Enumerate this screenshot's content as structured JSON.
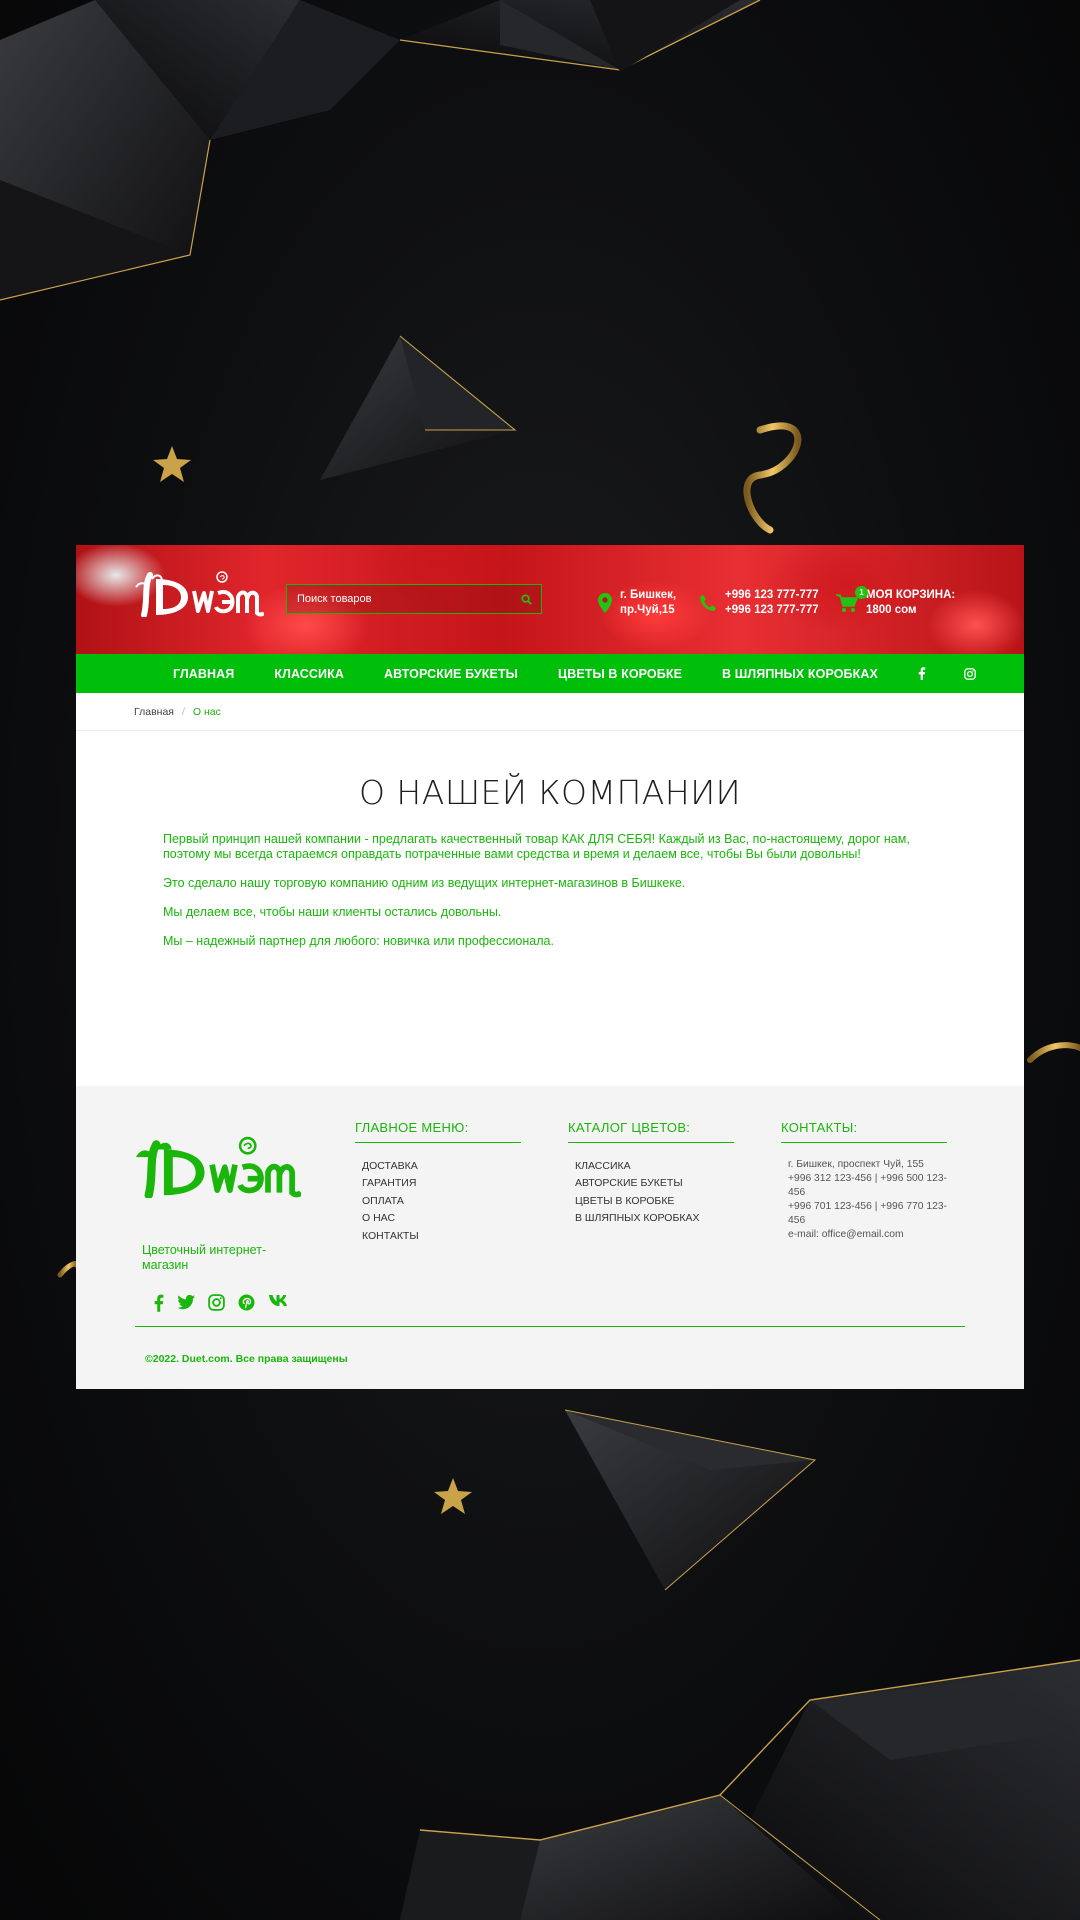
{
  "header": {
    "search_placeholder": "Поиск товаров",
    "address_line1": "г. Бишкек,",
    "address_line2": "пр.Чуй,15",
    "phone1": "+996 123 777-777",
    "phone2": "+996 123 777-777",
    "cart_label": "МОЯ КОРЗИНА:",
    "cart_total": "1800 сом",
    "cart_count": "1"
  },
  "nav": {
    "items": [
      "ГЛАВНАЯ",
      "КЛАССИКА",
      "АВТОРСКИЕ БУКЕТЫ",
      "ЦВЕТЫ В КОРОБКЕ",
      "В ШЛЯПНЫХ КОРОБКАХ"
    ],
    "social": [
      "facebook-icon",
      "instagram-icon"
    ]
  },
  "breadcrumb": {
    "home": "Главная",
    "separator": "/",
    "current": "О нас"
  },
  "main": {
    "title": "О НАШЕЙ КОМПАНИИ",
    "paragraphs": [
      "Первый принцип нашей компании - предлагать качественный товар КАК ДЛЯ СЕБЯ! Каждый из Вас, по-настоящему, дорог нам, поэтому мы всегда стараемся оправдать потраченные вами средства и время и делаем все, чтобы Вы были довольны!",
      "Это сделало нашу торговую компанию одним из ведущих интернет-магазинов в Бишкеке.",
      "Мы делаем все, чтобы наши клиенты остались довольны.",
      "Мы – надежный партнер для любого: новичка или профессионала."
    ]
  },
  "footer": {
    "tagline": "Цветочный интернет-магазин",
    "menu_title": "ГЛАВНОЕ МЕНЮ:",
    "menu_items": [
      "ДОСТАВКА",
      "ГАРАНТИЯ",
      "ОПЛАТА",
      "О НАС",
      "КОНТАКТЫ"
    ],
    "catalog_title": "КАТАЛОГ ЦВЕТОВ:",
    "catalog_items": [
      "КЛАССИКА",
      "АВТОРСКИЕ БУКЕТЫ",
      "ЦВЕТЫ В КОРОБКЕ",
      "В ШЛЯПНЫХ КОРОБКАХ"
    ],
    "contacts_title": "КОНТАКТЫ:",
    "contacts": [
      "г. Бишкек, проспект Чуй, 155",
      "+996 312 123-456 | +996 500 123-456",
      "+996 701 123-456 | +996 770 123-456",
      "e-mail: office@email.com"
    ],
    "social": [
      "facebook-icon",
      "twitter-icon",
      "instagram-icon",
      "pinterest-icon",
      "vk-icon"
    ],
    "copyright": "©2022. Duet.com. Все права защищены"
  },
  "colors": {
    "brand_green": "#00bf0a",
    "text_green": "#1ab60c",
    "header_red": "#c41519",
    "accent_gold": "#c9a24a"
  }
}
